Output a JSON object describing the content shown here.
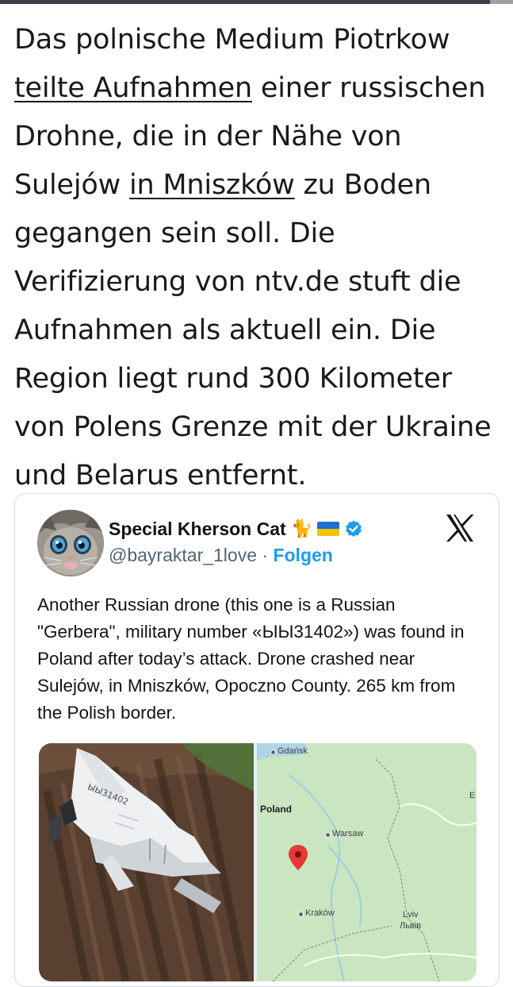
{
  "article": {
    "part1": "Das polnische Medium Piotrkow ",
    "link1": "teilte Aufnahmen",
    "part2": " einer russischen Drohne, die in der Nähe von Sulejów ",
    "link2": "in Mniszków",
    "part3": " zu Boden gegangen sein soll. Die Verifizierung von ntv.de stuft die Aufnahmen als aktuell ein. Die Region liegt rund 300 Kilometer von Polens Grenze mit der Ukraine und Belarus entfernt."
  },
  "tweet": {
    "display_name": "Special Kherson Cat",
    "name_emoji": "🐈",
    "handle": "@bayraktar_1love",
    "separator": "·",
    "follow_label": "Folgen",
    "text": "Another Russian drone (this one is a Russian \"Gerbera\", military number «ЫЫ31402») was found in Poland after today’s attack. Drone crashed near Sulejów, in Mniszków, Opoczno County. 265 km from the Polish border.",
    "photo_marking": "ЫЫ31402"
  },
  "map": {
    "labels": {
      "gdansk": "Gdańsk",
      "poland": "Poland",
      "warsaw": "Warsaw",
      "krakow": "Kraków",
      "lviv": "Lviv",
      "lviv_local": "Львів",
      "edge_letter": "E"
    }
  },
  "colors": {
    "link_blue": "#1d9bf0",
    "verified_badge": "#1d9bf0",
    "map_green": "#cde8c6",
    "pin_red": "#e53935"
  },
  "icons": [
    "verified-badge-icon",
    "x-logo-icon",
    "ukraine-flag-icon",
    "location-pin-icon"
  ]
}
